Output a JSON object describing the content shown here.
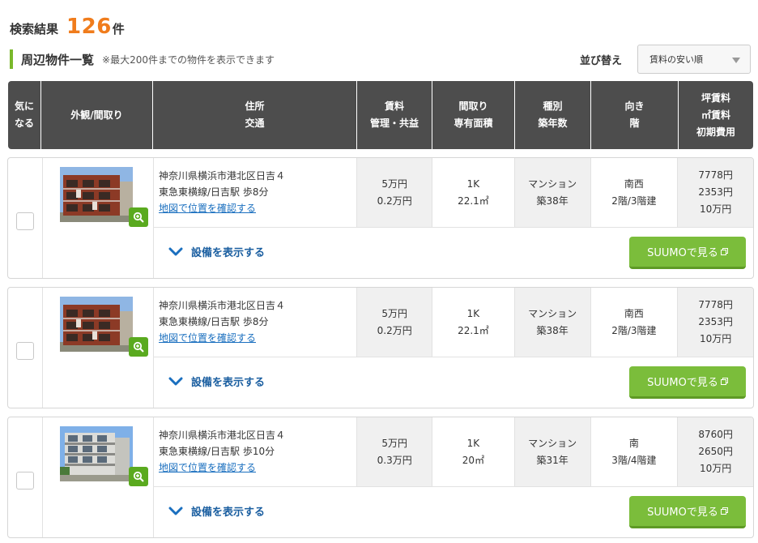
{
  "results": {
    "label": "検索結果",
    "count": "126",
    "unit": "件"
  },
  "section": {
    "title": "周辺物件一覧",
    "note": "※最大200件までの物件を表示できます"
  },
  "sort": {
    "label": "並び替え",
    "selected": "賃料の安い順"
  },
  "columns": [
    {
      "line1": "気に",
      "line2": "なる",
      "line3": ""
    },
    {
      "line1": "外観/間取り",
      "line2": "",
      "line3": ""
    },
    {
      "line1": "住所",
      "line2": "交通",
      "line3": ""
    },
    {
      "line1": "賃料",
      "line2": "管理・共益",
      "line3": ""
    },
    {
      "line1": "間取り",
      "line2": "専有面積",
      "line3": ""
    },
    {
      "line1": "種別",
      "line2": "築年数",
      "line3": ""
    },
    {
      "line1": "向き",
      "line2": "階",
      "line3": ""
    },
    {
      "line1": "坪賃料",
      "line2": "㎡賃料",
      "line3": "初期費用"
    }
  ],
  "listings": [
    {
      "address": "神奈川県横浜市港北区日吉４",
      "access": "東急東横線/日吉駅 歩8分",
      "map_link": "地図で位置を確認する",
      "rent": "5万円",
      "fee": "0.2万円",
      "layout": "1K",
      "area": "22.1㎡",
      "kind": "マンション",
      "age": "築38年",
      "direction": "南西",
      "floor": "2階/3階建",
      "tsubo_rent": "7778円",
      "sqm_rent": "2353円",
      "initial_cost": "10万円",
      "equipment_label": "設備を表示する",
      "suumo_label": "SUUMOで見る",
      "photo": "brick"
    },
    {
      "address": "神奈川県横浜市港北区日吉４",
      "access": "東急東横線/日吉駅 歩8分",
      "map_link": "地図で位置を確認する",
      "rent": "5万円",
      "fee": "0.2万円",
      "layout": "1K",
      "area": "22.1㎡",
      "kind": "マンション",
      "age": "築38年",
      "direction": "南西",
      "floor": "2階/3階建",
      "tsubo_rent": "7778円",
      "sqm_rent": "2353円",
      "initial_cost": "10万円",
      "equipment_label": "設備を表示する",
      "suumo_label": "SUUMOで見る",
      "photo": "brick"
    },
    {
      "address": "神奈川県横浜市港北区日吉４",
      "access": "東急東横線/日吉駅 歩10分",
      "map_link": "地図で位置を確認する",
      "rent": "5万円",
      "fee": "0.3万円",
      "layout": "1K",
      "area": "20㎡",
      "kind": "マンション",
      "age": "築31年",
      "direction": "南",
      "floor": "3階/4階建",
      "tsubo_rent": "8760円",
      "sqm_rent": "2650円",
      "initial_cost": "10万円",
      "equipment_label": "設備を表示する",
      "suumo_label": "SUUMOで見る",
      "photo": "white"
    }
  ],
  "colors": {
    "accent_orange": "#f07c1c",
    "green": "#7bbd3b",
    "header_bg": "#4d4d4d",
    "link_blue": "#1a6fbf"
  }
}
